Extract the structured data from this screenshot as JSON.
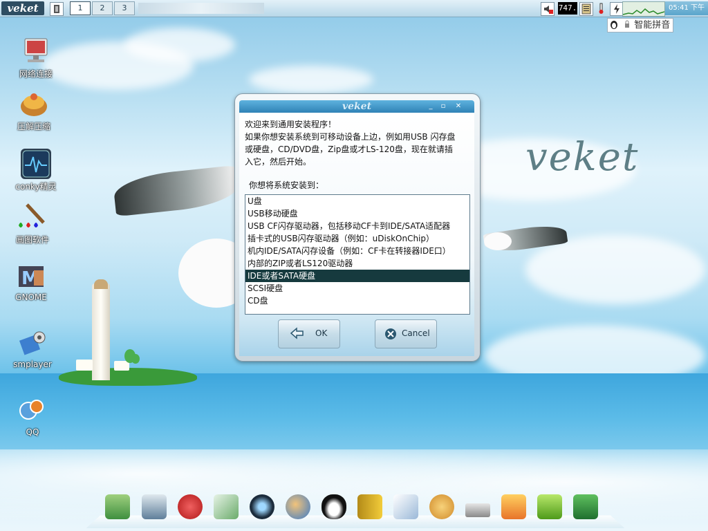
{
  "topbar": {
    "logo": "veket",
    "workspaces": [
      "1",
      "2",
      "3"
    ],
    "active_workspace": "1",
    "cpu_readout": "747.",
    "clock": "05:41 下午",
    "ime_label": "智能拼音"
  },
  "desktop_icons": [
    {
      "label": "网络连接",
      "icon": "network-icon"
    },
    {
      "label": "压解压缩",
      "icon": "archive-icon"
    },
    {
      "label": "conky精灵",
      "icon": "conky-icon"
    },
    {
      "label": "画图软件",
      "icon": "paint-icon"
    },
    {
      "label": "GNOME",
      "icon": "gnome-icon"
    },
    {
      "label": "smplayer",
      "icon": "smplayer-icon"
    },
    {
      "label": "QQ",
      "icon": "qq-icon"
    }
  ],
  "wallpaper_text": "veket",
  "dialog": {
    "title": "veket",
    "intro_lines": [
      "欢迎来到通用安装程序！",
      "如果你想安装系统到可移动设备上边，例如用USB 闪存盘",
      "或硬盘，CD/DVD盘，Zip盘或才LS-120盘，现在就请插",
      "入它，然后开始。"
    ],
    "prompt": "你想将系统安装到：",
    "options": [
      "U盘",
      "USB移动硬盘",
      "USB CF闪存驱动器，包括移动CF卡到IDE/SATA适配器",
      "插卡式的USB闪存驱动器（例如：uDiskOnChip）",
      "机内IDE/SATA闪存设备（例如：CF卡在转接器IDE口）",
      "内部的ZIP或者LS120驱动器",
      "IDE或者SATA硬盘",
      "SCSI硬盘",
      "CD盘"
    ],
    "selected_option": "IDE或者SATA硬盘",
    "ok_label": "OK",
    "cancel_label": "Cancel"
  },
  "dock_items": [
    "file-manager-icon",
    "monitor-icon",
    "hedgehog-icon",
    "editor-icon",
    "media-icon",
    "users-icon",
    "penguin-icon",
    "book-icon",
    "chart-icon",
    "palette-icon",
    "usb-drive-icon",
    "game-icon",
    "help-icon",
    "camera-icon"
  ],
  "colors": {
    "selection": "#163a3e",
    "titlebar": "#2f82b6",
    "sky": "#b8dff2"
  }
}
